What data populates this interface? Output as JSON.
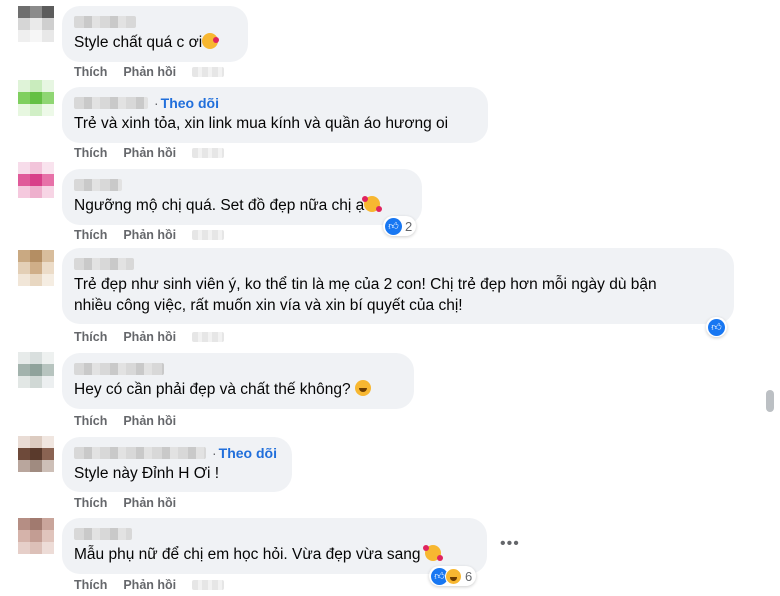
{
  "actions": {
    "like": "Thích",
    "reply": "Phản hồi"
  },
  "follow_label": "Theo dõi",
  "follow_dot": "·",
  "comments": [
    {
      "text": "Style chất quá c ơi",
      "emoji": "kissing-face-icon",
      "avatar_colors": [
        "#6e6e6e",
        "#8b8b8b",
        "#5c5c5c",
        "#d6d6d6",
        "#eaeaea",
        "#cfcfcf",
        "#efefef",
        "#f6f6f6",
        "#e8e8e8"
      ]
    },
    {
      "text": "Trẻ và xinh tỏa, xin link mua kính và quần áo hương oi",
      "follow": true,
      "avatar_colors": [
        "#dff3d8",
        "#c9ecbd",
        "#e7f6e2",
        "#7fcf5f",
        "#63c043",
        "#8fd673",
        "#e7f7e0",
        "#d1efc6",
        "#edf9e8"
      ]
    },
    {
      "text": "Ngưỡng mộ chị quá. Set đồ đẹp nữa chị ạ",
      "emoji": "smiling-face-with-hearts-icon",
      "reaction": {
        "count": "2"
      },
      "avatar_colors": [
        "#f7dcea",
        "#f2c4da",
        "#f9e3ee",
        "#e05a9a",
        "#d83f89",
        "#e771a8",
        "#f5c9de",
        "#eeb0cd",
        "#f7d5e5"
      ]
    },
    {
      "text": "Trẻ đẹp như sinh viên ý, ko thể tin là mẹ của 2 con! Chị trẻ đẹp hơn mỗi ngày dù bận\nnhiều công việc, rất muốn xin vía và xin bí quyết của chị!",
      "reaction": {
        "count": ""
      },
      "avatar_colors": [
        "#c9a982",
        "#b48e63",
        "#d8bd9c",
        "#e3cfb6",
        "#cfae88",
        "#ecdcc8",
        "#f1e6d8",
        "#e8d7c1",
        "#f5ede2"
      ]
    },
    {
      "text": "Hey có cần phải đẹp và chất thế không? ",
      "emoji": "grinning-face-icon",
      "avatar_colors": [
        "#e7ebea",
        "#d9dfde",
        "#eef1f0",
        "#a3b3ad",
        "#8fa29b",
        "#b7c4bf",
        "#e2e7e5",
        "#d0d8d5",
        "#eceff0"
      ]
    },
    {
      "text": "Style này Đỉnh H Ơi !",
      "follow": true,
      "avatar_colors": [
        "#e9dcd5",
        "#dccbc0",
        "#f0e6e0",
        "#6e4a3a",
        "#5a3a2c",
        "#8a6352",
        "#b9a69d",
        "#a08b80",
        "#cdbfb7"
      ]
    },
    {
      "text": "Mẫu phụ nữ để chị em học hỏi. Vừa đẹp vừa sang",
      "emoji": "smiling-face-with-hearts-icon",
      "reaction": {
        "count": "6"
      },
      "avatar_colors": [
        "#b58e84",
        "#a17a6f",
        "#c9a59b",
        "#d5b3aa",
        "#c39d93",
        "#e0c4bc",
        "#e6cfc9",
        "#dcc0b8",
        "#eddcd7"
      ]
    }
  ]
}
